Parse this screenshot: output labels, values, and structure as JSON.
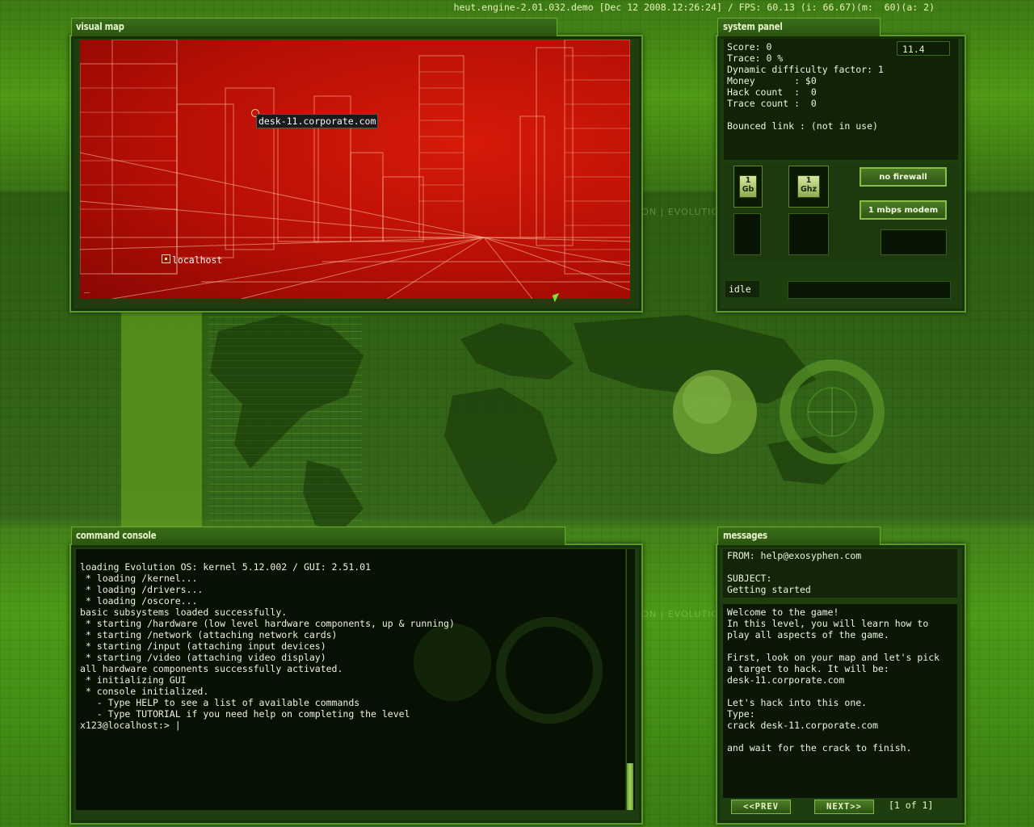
{
  "status_bar": {
    "text": "heut.engine-2.01.032.demo [Dec 12 2008.12:26:24] / FPS: 60.13 (i: 66.67)(m:  60)(a: 2)"
  },
  "visual_map": {
    "title": "visual map",
    "target_host": "desk-11.corporate.com",
    "local_host": "localhost",
    "prompt_mark": "_"
  },
  "system_panel": {
    "title": "system panel",
    "lines": [
      "Score: 0",
      "Trace: 0 %",
      "Dynamic difficulty factor: 1",
      "Money       : $0",
      "Hack count  :  0",
      "Trace count :  0",
      "",
      "Bounced link : (not in use)"
    ],
    "score_readout": "11.4",
    "memory_chip": "1\nGb",
    "cpu_chip": "1\nGhz",
    "firewall_label": "no firewall",
    "modem_label": "1 mbps modem",
    "status": "idle"
  },
  "background": {
    "evolution_text_1": "ION | EVOLUTIO",
    "evolution_text_2": "ION | EVOLUTIO"
  },
  "command_console": {
    "title": "command console",
    "lines": [
      "loading Evolution OS: kernel 5.12.002 / GUI: 2.51.01",
      " * loading /kernel...",
      " * loading /drivers...",
      " * loading /oscore...",
      "basic subsystems loaded successfully.",
      " * starting /hardware (low level hardware components, up & running)",
      " * starting /network (attaching network cards)",
      " * starting /input (attaching input devices)",
      " * starting /video (attaching video display)",
      "all hardware components successfully activated.",
      " * initializing GUI",
      " * console initialized.",
      "   - Type HELP to see a list of available commands",
      "   - Type TUTORIAL if you need help on completing the level",
      "x123@localhost:> |"
    ]
  },
  "messages": {
    "title": "messages",
    "from": "FROM: help@exosyphen.com",
    "subject_label": "SUBJECT:",
    "subject": "Getting started",
    "body": [
      "Welcome to the game!",
      "In this level, you will learn how to",
      "play all aspects of the game.",
      "",
      "First, look on your map and let's pick",
      "a target to hack. It will be:",
      "desk-11.corporate.com",
      "",
      "Let's hack into this one.",
      "Type:",
      "crack desk-11.corporate.com",
      "",
      "and wait for the crack to finish."
    ],
    "prev_label": "<<PREV",
    "next_label": "NEXT>>",
    "page_indicator": "[1 of 1]"
  }
}
